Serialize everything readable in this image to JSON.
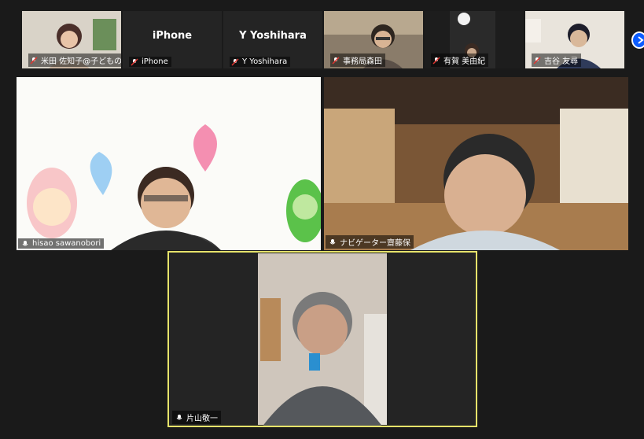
{
  "thumbnails": [
    {
      "name": "米田 佐知子@子どもの…",
      "video": true,
      "muted": true
    },
    {
      "name": "iPhone",
      "label": "iPhone",
      "video": false,
      "muted": true
    },
    {
      "name": "Y Yoshihara",
      "label": "Y Yoshihara",
      "video": false,
      "muted": true
    },
    {
      "name": "事務局森田",
      "video": true,
      "muted": true
    },
    {
      "name": "有賀 美由紀",
      "video": true,
      "muted": true
    },
    {
      "name": "吉谷 友尋",
      "video": true,
      "muted": true
    }
  ],
  "main": [
    {
      "name": "hisao sawanobori",
      "muted": false
    },
    {
      "name": "ナビゲーター齋藤保",
      "muted": false
    }
  ],
  "speaker": {
    "name": "片山敬一",
    "muted": false
  },
  "colors": {
    "accent": "#e6e36a",
    "next_button": "#0b5cff"
  }
}
